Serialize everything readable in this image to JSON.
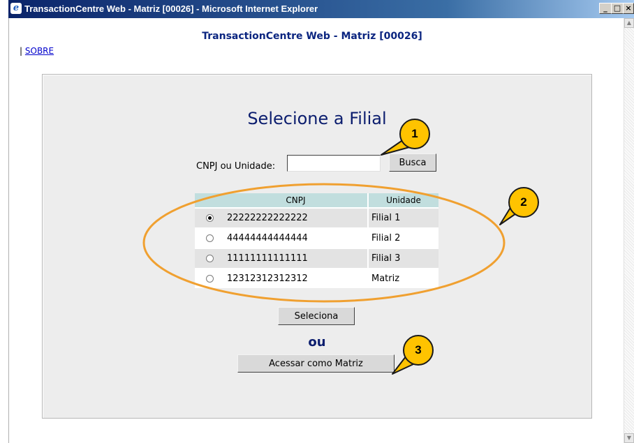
{
  "window": {
    "title": "TransactionCentre Web - Matriz [00026] - Microsoft Internet Explorer",
    "buttons": {
      "minimize": "_",
      "maximize": "□",
      "close": "×"
    }
  },
  "page": {
    "header": "TransactionCentre Web - Matriz [00026]",
    "nav_separator": "|",
    "nav_link": "SOBRE"
  },
  "form": {
    "title": "Selecione a Filial",
    "search_label": "CNPJ ou Unidade:",
    "search_value": "",
    "search_button": "Busca",
    "columns": [
      "CNPJ",
      "Unidade"
    ],
    "rows": [
      {
        "cnpj": "22222222222222",
        "unidade": "Filial 1",
        "selected": true
      },
      {
        "cnpj": "44444444444444",
        "unidade": "Filial 2",
        "selected": false
      },
      {
        "cnpj": "11111111111111",
        "unidade": "Filial 3",
        "selected": false
      },
      {
        "cnpj": "12312312312312",
        "unidade": "Matriz",
        "selected": false
      }
    ],
    "select_button": "Seleciona",
    "or_text": "ou",
    "matriz_button": "Acessar como Matriz"
  },
  "callouts": [
    "1",
    "2",
    "3"
  ],
  "colors": {
    "callout_fill": "#ffc300",
    "highlight_ellipse": "#f0a030",
    "title_blue": "#0b1d6e"
  }
}
